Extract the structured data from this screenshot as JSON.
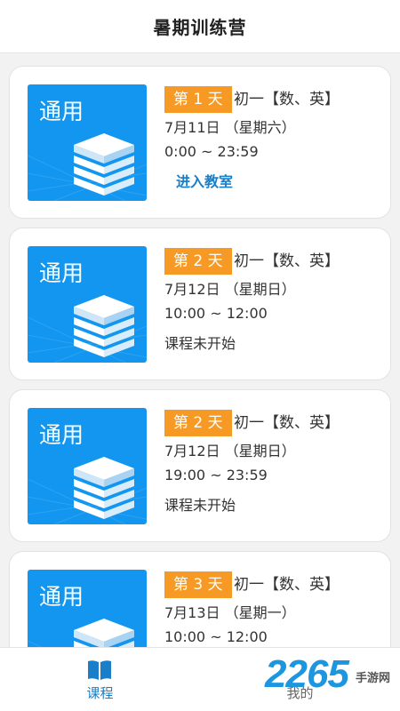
{
  "header": {
    "title": "暑期训练营"
  },
  "courses": [
    {
      "thumb_label": "通用",
      "day": "第 1 天",
      "grade": "初一【数、英】",
      "date": "7月11日 （星期六）",
      "time": "0:00 ~ 23:59",
      "status": "进入教室"
    },
    {
      "thumb_label": "通用",
      "day": "第 2 天",
      "grade": "初一【数、英】",
      "date": "7月12日 （星期日）",
      "time": "10:00 ~ 12:00",
      "status": "课程未开始"
    },
    {
      "thumb_label": "通用",
      "day": "第 2 天",
      "grade": "初一【数、英】",
      "date": "7月12日 （星期日）",
      "time": "19:00 ~ 23:59",
      "status": "课程未开始"
    },
    {
      "thumb_label": "通用",
      "day": "第 3 天",
      "grade": "初一【数、英】",
      "date": "7月13日 （星期一）",
      "time": "10:00 ~ 12:00",
      "status": ""
    }
  ],
  "tabbar": {
    "courses_label": "课程",
    "mine_label": "我的"
  },
  "watermark": {
    "number": "2265",
    "text": "手游网"
  },
  "colors": {
    "accent": "#1a7fc8",
    "badge": "#f79a25",
    "thumb": "#1296f0"
  }
}
